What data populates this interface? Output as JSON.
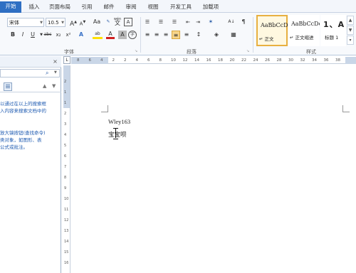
{
  "tabs": [
    {
      "label": "开始",
      "active": true
    },
    {
      "label": "插入"
    },
    {
      "label": "页面布局"
    },
    {
      "label": "引用"
    },
    {
      "label": "邮件"
    },
    {
      "label": "审阅"
    },
    {
      "label": "视图"
    },
    {
      "label": "开发工具"
    },
    {
      "label": "加载项"
    }
  ],
  "font": {
    "name": "宋体",
    "size": "10.5",
    "group_label": "字体",
    "grow_label": "A",
    "shrink_label": "A",
    "change_case_label": "Aa",
    "phonetic_label": "wén",
    "char_border_label": "A",
    "bold": "B",
    "italic": "I",
    "underline": "U",
    "strike": "abc",
    "subscript": "x₂",
    "superscript": "x²",
    "effects": "A",
    "highlight": "ab",
    "font_color": "A",
    "char_shade": "A",
    "enclose": "字"
  },
  "paragraph": {
    "group_label": "段落",
    "sort_label": "A↓",
    "show_marks": "¶"
  },
  "styles": {
    "group_label": "样式",
    "items": [
      {
        "sample": "AaBbCcDc",
        "name": "↵ 正文",
        "selected": true
      },
      {
        "sample": "AaBbCcDc",
        "name": "↵ 正文缩进"
      },
      {
        "sample": "1、A",
        "name": "标题 1"
      }
    ]
  },
  "nav": {
    "text_lines": [
      "以通过在以上的搜索框",
      "入内容来搜索文档中的",
      "",
      "放大镜按钮(查找命令)",
      "类对象，如图形、表",
      "公式或批注。"
    ]
  },
  "ruler": {
    "corner_symbol": "L",
    "h_ticks": [
      "8",
      "6",
      "4",
      "2",
      "2",
      "4",
      "6",
      "8",
      "10",
      "12",
      "14",
      "16",
      "18",
      "20",
      "22",
      "24",
      "26",
      "28",
      "30",
      "32",
      "34",
      "36",
      "38"
    ],
    "v_ticks": [
      "2",
      "1",
      "1",
      "2",
      "3",
      "4",
      "5",
      "6",
      "7",
      "8",
      "9",
      "10",
      "11",
      "12",
      "13",
      "14",
      "15",
      "16"
    ]
  },
  "document": {
    "line1": "Wley163",
    "line2": "宝宝呗"
  },
  "colors": {
    "accent": "#2f6fc3",
    "ribbon_bg": "#f7f9fc",
    "highlight_yellow": "#ffe000",
    "font_red": "#d02020",
    "selected_style_border": "#e8b040"
  }
}
